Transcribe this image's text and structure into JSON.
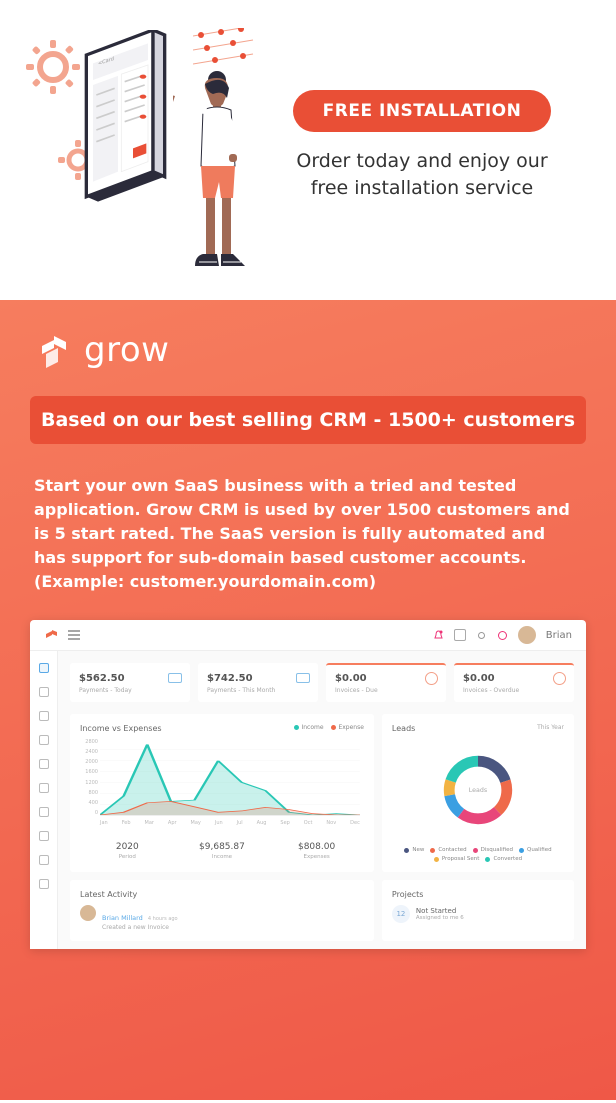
{
  "top": {
    "pill": "FREE INSTALLATION",
    "sub": "Order today and enjoy our free installation service"
  },
  "brand": "grow",
  "based": "Based on our best selling CRM - 1500+ customers",
  "desc": "Start your own SaaS business with a tried and tested application. Grow CRM is used by over 1500 customers and is 5 start rated. The SaaS version is fully automated and has support for sub-domain based customer accounts. (Example: customer.yourdomain.com)",
  "dash": {
    "user": "Brian",
    "cards": [
      {
        "value": "$562.50",
        "label": "Payments - Today",
        "orange": false,
        "red": false
      },
      {
        "value": "$742.50",
        "label": "Payments - This Month",
        "orange": false,
        "red": false
      },
      {
        "value": "$0.00",
        "label": "Invoices - Due",
        "orange": true,
        "red": true
      },
      {
        "value": "$0.00",
        "label": "Invoices - Overdue",
        "orange": true,
        "red": true
      }
    ],
    "chart_title": "Income vs Expenses",
    "chart_legend": {
      "a": "Income",
      "b": "Expense"
    },
    "summary": [
      {
        "v": "2020",
        "l": "Period"
      },
      {
        "v": "$9,685.87",
        "l": "Income"
      },
      {
        "v": "$808.00",
        "l": "Expenses"
      }
    ],
    "leads_title": "Leads",
    "leads_period": "This Year",
    "leads_center": "Leads",
    "leads_legend": [
      {
        "l": "New",
        "c": "#4a5680"
      },
      {
        "l": "Contacted",
        "c": "#ef6a4a"
      },
      {
        "l": "Disqualified",
        "c": "#e8467a"
      },
      {
        "l": "Qualified",
        "c": "#3b9fe2"
      },
      {
        "l": "Proposal Sent",
        "c": "#f2b343"
      },
      {
        "l": "Converted",
        "c": "#29c7b5"
      }
    ],
    "activity_title": "Latest Activity",
    "activity": {
      "name": "Brian Millard",
      "ago": "4 hours ago",
      "desc": "Created a new Invoice"
    },
    "projects_title": "Projects",
    "proj": {
      "n": "12",
      "t": "Not Started",
      "s": "Assigned to me 6"
    }
  },
  "chart_data": {
    "type": "line",
    "title": "Income vs Expenses",
    "xlabel": "",
    "ylabel": "",
    "ylim": [
      0,
      2800
    ],
    "categories": [
      "Jan",
      "Feb",
      "Mar",
      "Apr",
      "May",
      "Jun",
      "Jul",
      "Aug",
      "Sep",
      "Oct",
      "Nov",
      "Dec"
    ],
    "series": [
      {
        "name": "Income",
        "values": [
          0,
          700,
          2600,
          500,
          550,
          2000,
          1200,
          900,
          100,
          0,
          50,
          0
        ]
      },
      {
        "name": "Expense",
        "values": [
          0,
          100,
          450,
          500,
          300,
          100,
          150,
          280,
          200,
          50,
          0,
          0
        ]
      }
    ],
    "donut": {
      "type": "pie",
      "title": "Leads",
      "slices": [
        {
          "label": "New",
          "value": 20,
          "color": "#4a5680"
        },
        {
          "label": "Contacted",
          "value": 18,
          "color": "#ef6a4a"
        },
        {
          "label": "Disqualified",
          "value": 22,
          "color": "#e8467a"
        },
        {
          "label": "Qualified",
          "value": 12,
          "color": "#3b9fe2"
        },
        {
          "label": "Proposal Sent",
          "value": 8,
          "color": "#f2b343"
        },
        {
          "label": "Converted",
          "value": 20,
          "color": "#29c7b5"
        }
      ]
    }
  }
}
